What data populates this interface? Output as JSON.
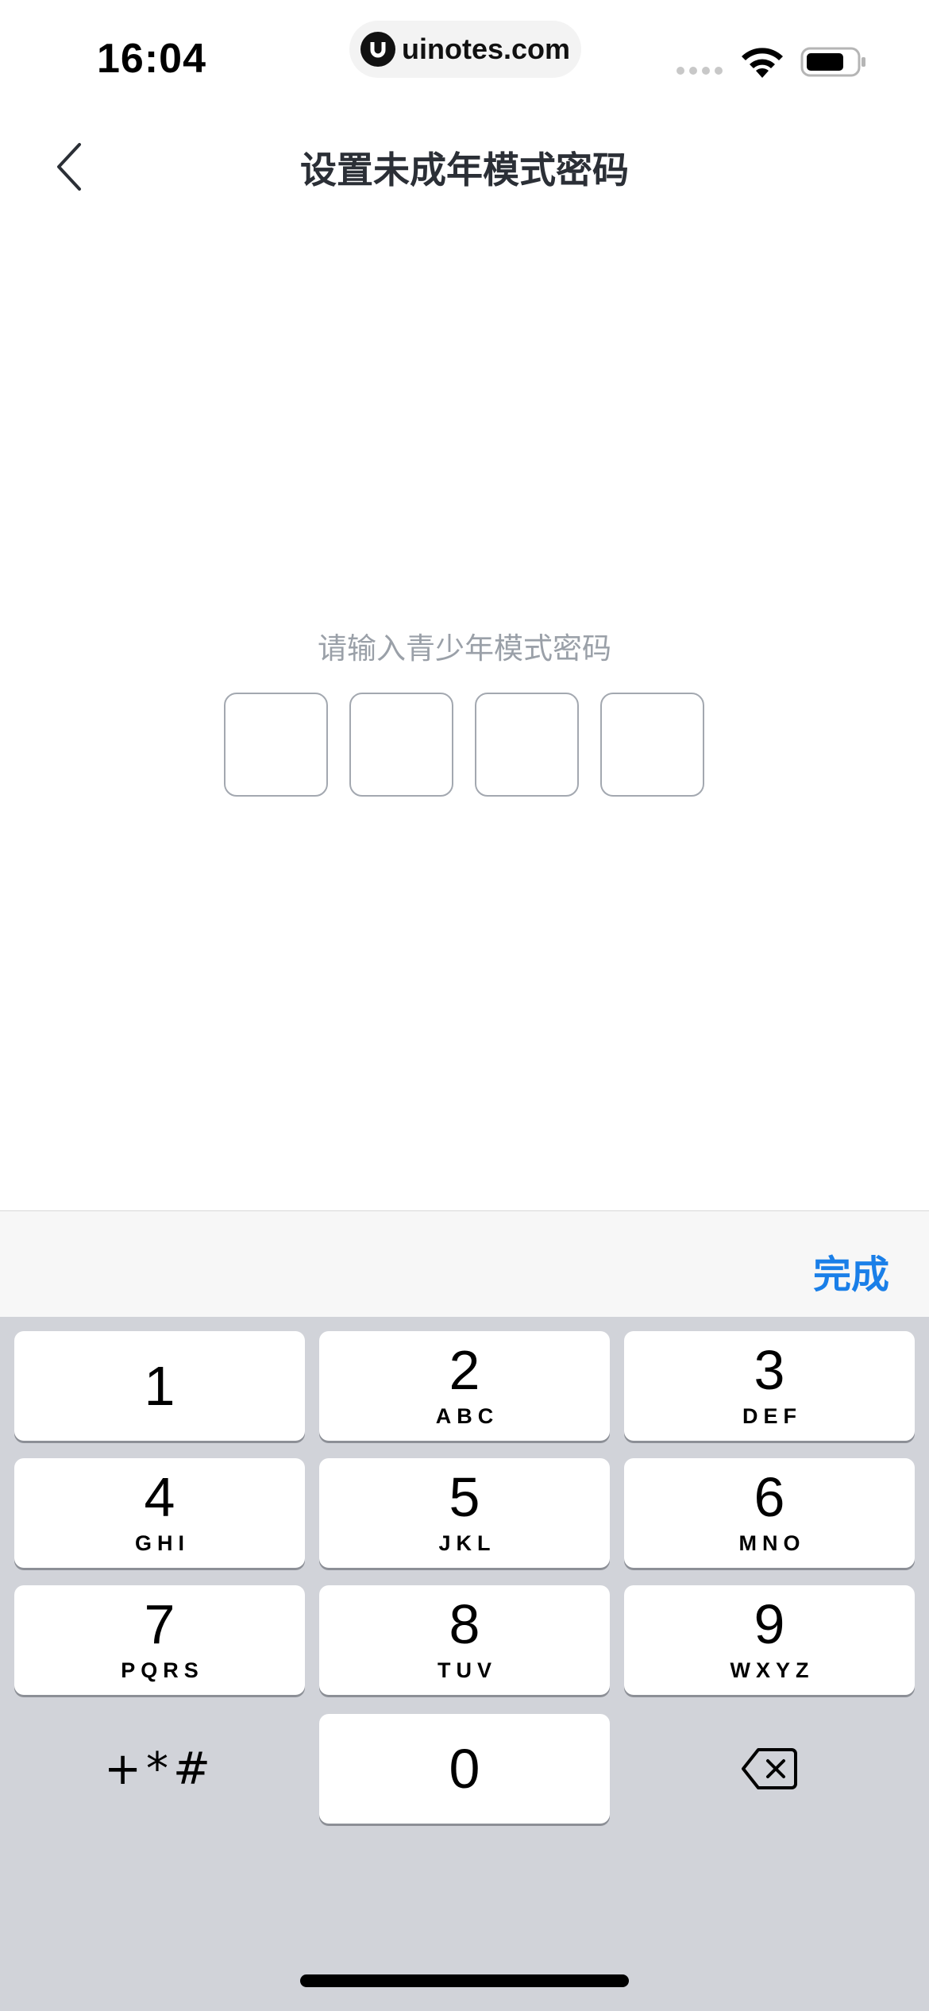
{
  "status_bar": {
    "time": "16:04",
    "watermark": "uinotes.com"
  },
  "nav": {
    "title": "设置未成年模式密码"
  },
  "prompt": "请输入青少年模式密码",
  "code_boxes": [
    "",
    "",
    "",
    ""
  ],
  "accessory": {
    "done_label": "完成",
    "accent_color": "#1a7fe8"
  },
  "keypad": {
    "keys": [
      {
        "digit": "1",
        "letters": ""
      },
      {
        "digit": "2",
        "letters": "ABC"
      },
      {
        "digit": "3",
        "letters": "DEF"
      },
      {
        "digit": "4",
        "letters": "GHI"
      },
      {
        "digit": "5",
        "letters": "JKL"
      },
      {
        "digit": "6",
        "letters": "MNO"
      },
      {
        "digit": "7",
        "letters": "PQRS"
      },
      {
        "digit": "8",
        "letters": "TUV"
      },
      {
        "digit": "9",
        "letters": "WXYZ"
      }
    ],
    "symbols_label": "+*#",
    "zero": "0",
    "delete_icon": "backspace-icon"
  }
}
